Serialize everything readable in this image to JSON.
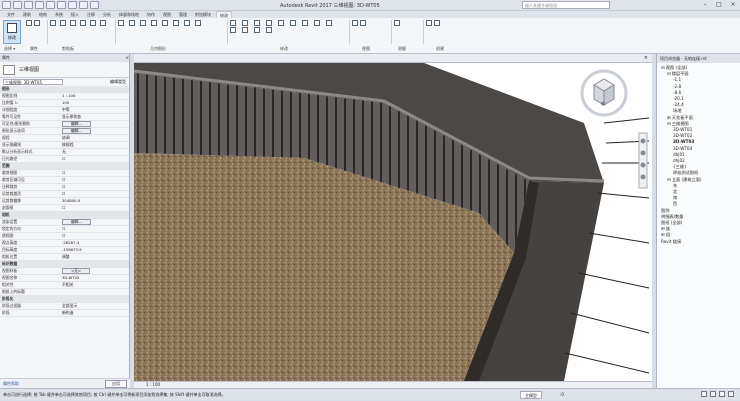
{
  "titlebar": {
    "app_title": "Autodesk Revit 2017    三维视图: 3D-WT05",
    "search_placeholder": "键入关键字或短语"
  },
  "tabs": [
    "文件",
    "建筑",
    "结构",
    "系统",
    "插入",
    "注释",
    "分析",
    "体量和场地",
    "协作",
    "视图",
    "管理",
    "附加模块",
    "修改"
  ],
  "active_tab": "修改",
  "ribbon": {
    "modify_label": "修改",
    "panels": [
      "选择 ▾",
      "属性",
      "剪贴板",
      "几何图形",
      "修改",
      "视图",
      "测量",
      "创建"
    ]
  },
  "properties": {
    "title": "属性",
    "close": "×",
    "type_name": "三维视图",
    "selector_value": "三维视图: 3D-WT05",
    "edit_type": "编辑类型",
    "rows": [
      {
        "k": "图形",
        "v": "",
        "group": true
      },
      {
        "k": "视图比例",
        "v": "1 : 100"
      },
      {
        "k": "比例值 1:",
        "v": "100"
      },
      {
        "k": "详细程度",
        "v": "中等"
      },
      {
        "k": "零件可见性",
        "v": "显示原状态"
      },
      {
        "k": "可见性/图形替换",
        "v": "编辑...",
        "btn": true
      },
      {
        "k": "图形显示选项",
        "v": "编辑...",
        "btn": true
      },
      {
        "k": "规程",
        "v": "协调"
      },
      {
        "k": "显示隐藏线",
        "v": "按规程"
      },
      {
        "k": "默认分析显示样式",
        "v": "无"
      },
      {
        "k": "日光路径",
        "v": "☐"
      },
      {
        "k": "范围",
        "v": "",
        "group": true
      },
      {
        "k": "裁剪视图",
        "v": "☐"
      },
      {
        "k": "裁剪区域可见",
        "v": "☐"
      },
      {
        "k": "注释裁剪",
        "v": "☐"
      },
      {
        "k": "远剪裁激活",
        "v": "☐"
      },
      {
        "k": "远剪裁偏移",
        "v": "304800.0"
      },
      {
        "k": "剖面框",
        "v": "☐"
      },
      {
        "k": "相机",
        "v": "",
        "group": true
      },
      {
        "k": "渲染设置",
        "v": "编辑...",
        "btn": true
      },
      {
        "k": "锁定的方向",
        "v": "☐"
      },
      {
        "k": "透视图",
        "v": "☐"
      },
      {
        "k": "视点高度",
        "v": "-28267.4"
      },
      {
        "k": "目标高度",
        "v": "-158673.9"
      },
      {
        "k": "相机位置",
        "v": "调整"
      },
      {
        "k": "标识数据",
        "v": "",
        "group": true
      },
      {
        "k": "视图样板",
        "v": "<无>",
        "btn": true
      },
      {
        "k": "视图名称",
        "v": "3D-WT05"
      },
      {
        "k": "相关性",
        "v": "不相关"
      },
      {
        "k": "图纸上的标题",
        "v": ""
      },
      {
        "k": "阶段化",
        "v": "",
        "group": true
      },
      {
        "k": "阶段过滤器",
        "v": "全部显示"
      },
      {
        "k": "阶段",
        "v": "新构造"
      }
    ],
    "help_link": "属性帮助",
    "apply": "应用"
  },
  "viewport": {
    "tab_close": "×",
    "scale": "1 : 100",
    "viewcube_label": "前"
  },
  "browser": {
    "title": "项目浏览器 - 无地连接.rvt",
    "nodes": [
      {
        "t": "⊟ 视图 (全部)",
        "l": 0
      },
      {
        "t": "⊟ 楼层平面",
        "l": 1
      },
      {
        "t": "-1.1",
        "l": 2
      },
      {
        "t": "-2.8",
        "l": 2
      },
      {
        "t": "-8.6",
        "l": 2
      },
      {
        "t": "-20.1",
        "l": 2
      },
      {
        "t": "-24.4",
        "l": 2
      },
      {
        "t": "场地",
        "l": 2
      },
      {
        "t": "⊞ 天花板平面",
        "l": 1
      },
      {
        "t": "⊟ 三维视图",
        "l": 1
      },
      {
        "t": "3D-WT01",
        "l": 2
      },
      {
        "t": "3D-WT02",
        "l": 2
      },
      {
        "t": "3D-WT03",
        "l": 2,
        "sel": true
      },
      {
        "t": "3D-WT04",
        "l": 2
      },
      {
        "t": "dhj01",
        "l": 2
      },
      {
        "t": "dhj02",
        "l": 2
      },
      {
        "t": "{三维}",
        "l": 2
      },
      {
        "t": "原始测试图纸",
        "l": 2
      },
      {
        "t": "⊟ 立面 (建筑立面)",
        "l": 1
      },
      {
        "t": "东",
        "l": 2
      },
      {
        "t": "北",
        "l": 2
      },
      {
        "t": "南",
        "l": 2
      },
      {
        "t": "西",
        "l": 2
      },
      {
        "t": "图例",
        "l": 0
      },
      {
        "t": "明细表/数量",
        "l": 0
      },
      {
        "t": "图纸 (全部)",
        "l": 0
      },
      {
        "t": "⊞ 族",
        "l": 0
      },
      {
        "t": "⊞ 组",
        "l": 0
      },
      {
        "t": "Revit 链接",
        "l": 0
      }
    ]
  },
  "statusbar": {
    "hint": "单击可进行选择; 按 Tab 键并单击可选择其他项目; 按 Ctrl 键并单击可将新项目添加到选择集; 按 Shift 键并单击可取消选择。",
    "model": "主模型",
    "zero": ":0"
  },
  "colors": {
    "wall": "#4a4542",
    "ground": "#8a7458",
    "selected_blue": "#2a5fa5"
  }
}
